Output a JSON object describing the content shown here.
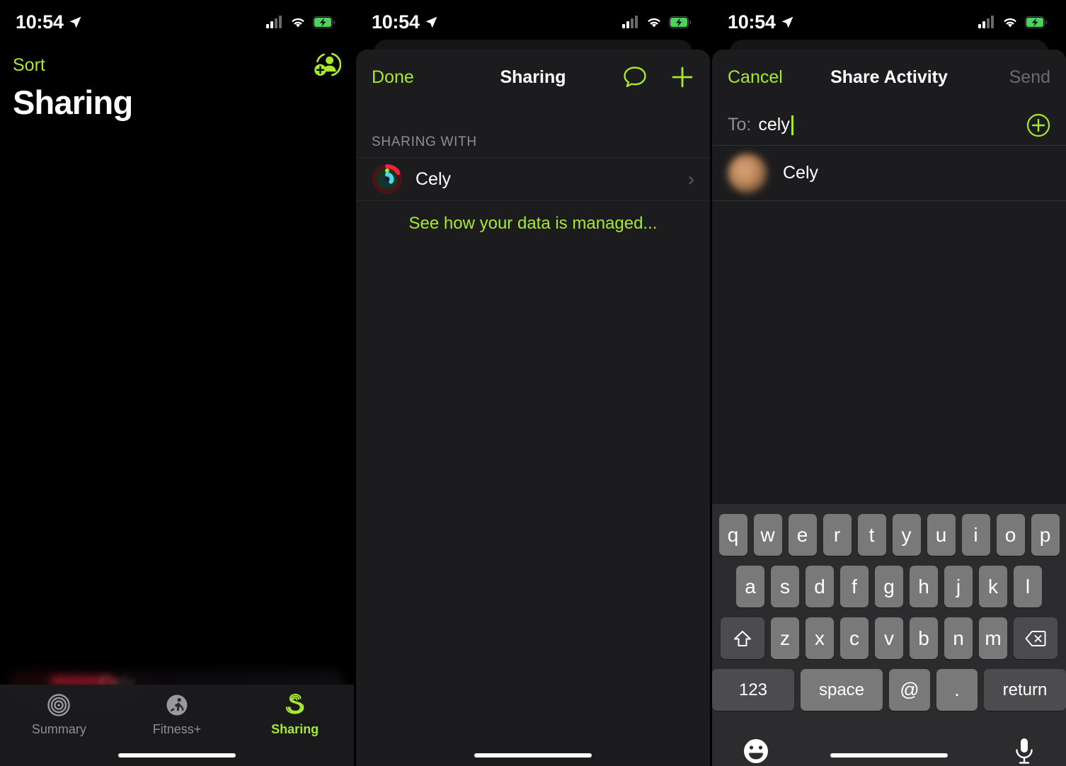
{
  "statusbar": {
    "time": "10:54",
    "location_icon": "location-arrow-icon",
    "cellular_icon": "cellular-bars-icon",
    "wifi_icon": "wifi-icon",
    "battery_icon": "battery-charging-icon"
  },
  "colors": {
    "accent_green": "#a8e82f",
    "background": "#000000",
    "sheet_background": "#1c1c1e",
    "keyboard_background": "#2c2c2e",
    "key_fill": "#797979",
    "key_dark_fill": "#4c4c4e",
    "secondary_text": "#8e8e93",
    "disabled_text": "#6b6b6e"
  },
  "panel1": {
    "nav": {
      "sort_label": "Sort",
      "add_person_icon": "add-person-icon"
    },
    "title": "Sharing",
    "ghost_card_text": "Cely",
    "tabbar": {
      "tabs": [
        {
          "label": "Summary",
          "icon": "activity-rings-icon",
          "active": false
        },
        {
          "label": "Fitness+",
          "icon": "running-person-icon",
          "active": false
        },
        {
          "label": "Sharing",
          "icon": "sharing-s-icon",
          "active": true
        }
      ]
    }
  },
  "panel2": {
    "nav": {
      "done_label": "Done",
      "title": "Sharing",
      "message_icon": "message-bubble-icon",
      "add_icon": "plus-icon"
    },
    "section_header": "SHARING WITH",
    "rows": [
      {
        "name": "Cely",
        "avatar": "activity-rings-avatar",
        "chevron": "chevron-right-icon"
      }
    ],
    "data_link": "See how your data is managed..."
  },
  "panel3": {
    "nav": {
      "cancel_label": "Cancel",
      "title": "Share Activity",
      "send_label": "Send"
    },
    "to_field": {
      "label": "To:",
      "value": "cely",
      "add_contact_icon": "circled-plus-icon"
    },
    "suggestions": [
      {
        "name": "Cely",
        "avatar": "contact-photo"
      }
    ],
    "keyboard": {
      "row1": [
        "q",
        "w",
        "e",
        "r",
        "t",
        "y",
        "u",
        "i",
        "o",
        "p"
      ],
      "row2": [
        "a",
        "s",
        "d",
        "f",
        "g",
        "h",
        "j",
        "k",
        "l"
      ],
      "row3": [
        "z",
        "x",
        "c",
        "v",
        "b",
        "n",
        "m"
      ],
      "shift_icon": "shift-arrow-icon",
      "backspace_icon": "backspace-icon",
      "numbers_label": "123",
      "space_label": "space",
      "at_label": "@",
      "dot_label": ".",
      "return_label": "return",
      "emoji_icon": "emoji-smiley-icon",
      "dictation_icon": "microphone-icon"
    }
  }
}
